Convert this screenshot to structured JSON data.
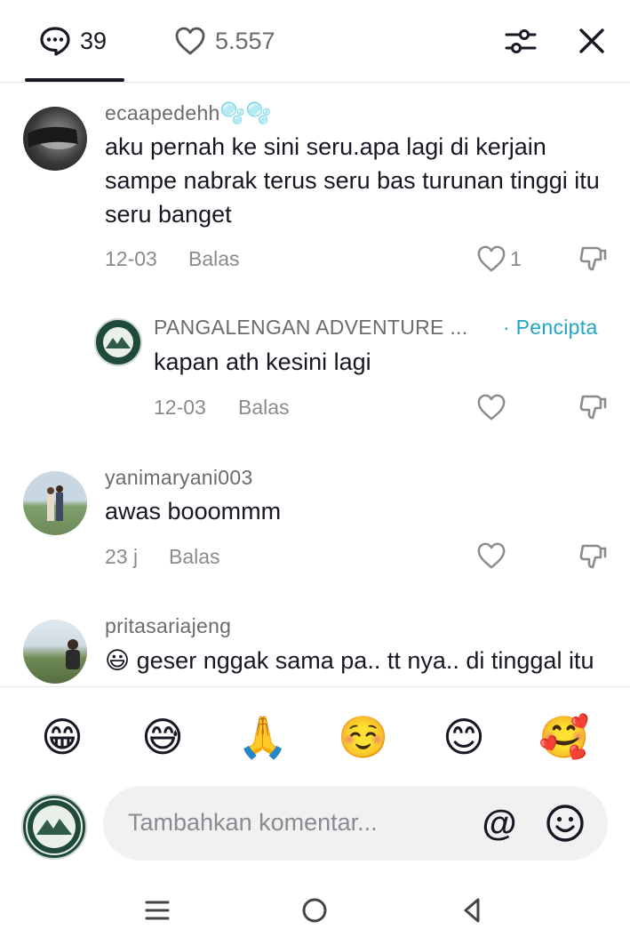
{
  "header": {
    "comments_count": "39",
    "likes_count": "5.557"
  },
  "comments": [
    {
      "username": "ecaapedehh🫧🫧",
      "text": "aku pernah ke sini seru.apa lagi di kerjain sampe nabrak terus seru bas turunan tinggi itu seru banget",
      "date": "12-03",
      "reply_label": "Balas",
      "likes": "1"
    },
    {
      "username": "PANGALENGAN ADVENTURE ...",
      "creator_label": "· Pencipta",
      "text": "kapan ath kesini lagi",
      "date": "12-03",
      "reply_label": "Balas"
    },
    {
      "username": "yanimaryani003",
      "text": "awas booommm",
      "date": "23 j",
      "reply_label": "Balas"
    },
    {
      "username": "pritasariajeng",
      "text": "😃 geser nggak sama pa.. tt nya.. di tinggal itu sm tt",
      "date": "",
      "reply_label": ""
    }
  ],
  "emoji_bar": [
    "😁",
    "😅",
    "🙏",
    "☺️",
    "😊",
    "🥰"
  ],
  "composer": {
    "placeholder": "Tambahkan komentar...",
    "at_symbol": "@"
  },
  "icons": [
    "comment-icon",
    "heart-icon",
    "filter-icon",
    "close-icon",
    "dislike-icon",
    "emoji-icon",
    "menu-icon",
    "home-circle-icon",
    "back-triangle-icon"
  ],
  "colors": {
    "creator": "#20a5c4",
    "text": "#161823",
    "muted": "#8a8a90"
  }
}
